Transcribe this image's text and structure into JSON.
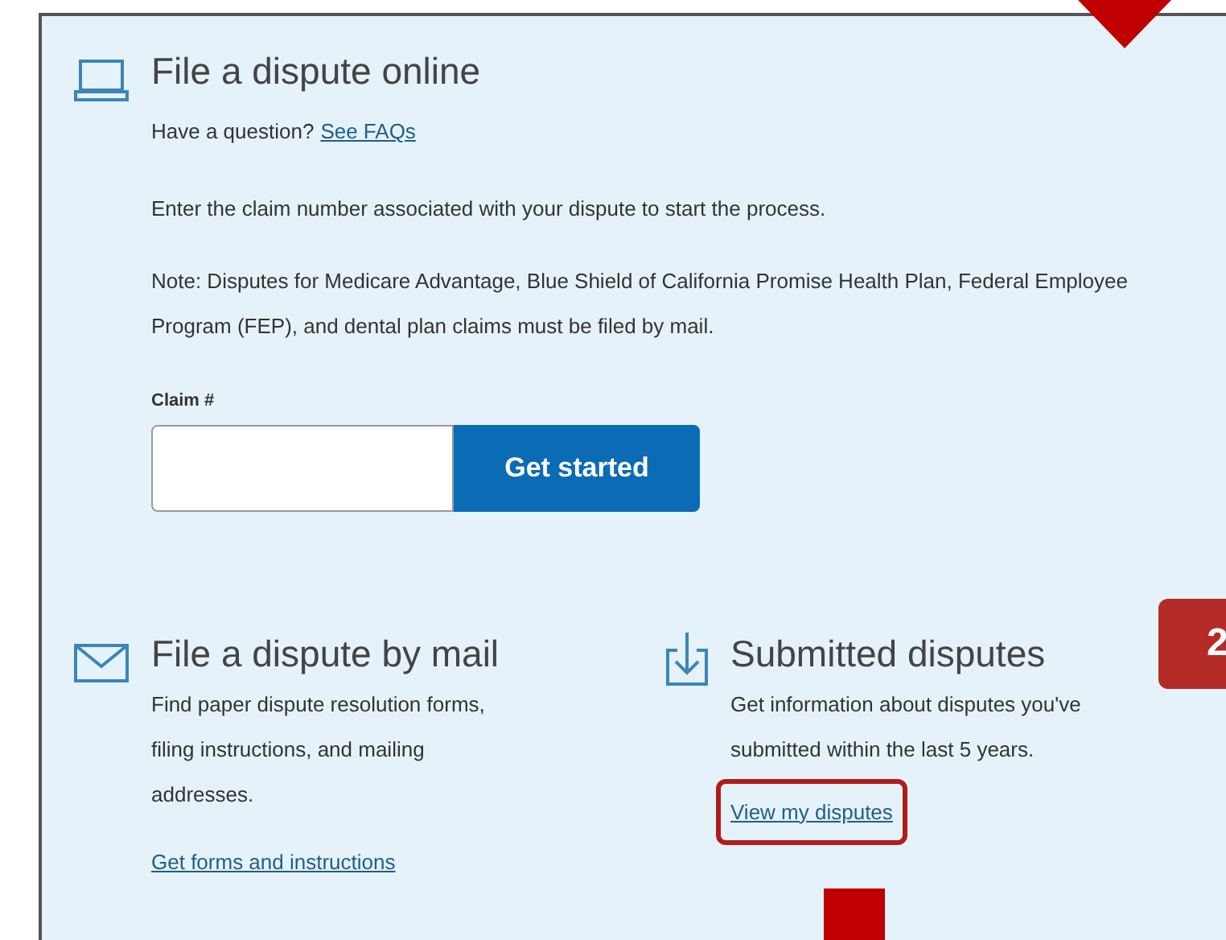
{
  "online": {
    "title": "File a dispute online",
    "question": "Have a question?",
    "faq_link": "See FAQs",
    "instruction": "Enter the claim number associated with your dispute to start the process.",
    "note": "Note: Disputes for Medicare Advantage, Blue Shield of California Promise Health Plan, Federal Employee Program (FEP), and dental plan claims must be filed by mail.",
    "claim_label": "Claim #",
    "button": "Get started"
  },
  "mail": {
    "title": "File a dispute by mail",
    "text": "Find paper dispute resolution forms, filing instructions, and mailing addresses.",
    "link": "Get forms and instructions"
  },
  "submitted": {
    "title": "Submitted disputes",
    "text": "Get information about disputes you've submitted within the last 5 years.",
    "link": "View my disputes"
  },
  "annotation": {
    "badge": "2"
  }
}
